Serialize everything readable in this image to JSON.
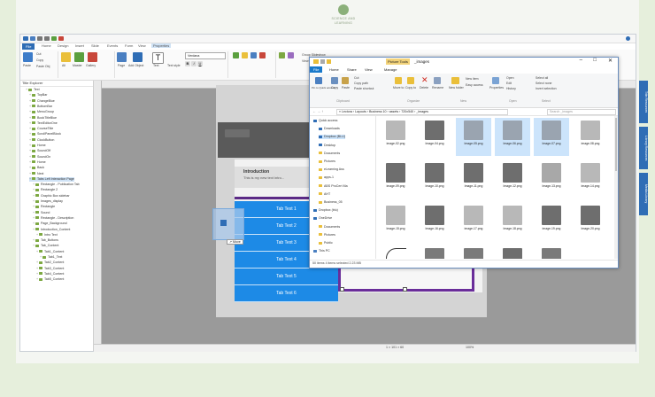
{
  "branding": {
    "line1": "SCIENCE AND",
    "line2": "LEARNING"
  },
  "app": {
    "ribbon_tabs": [
      "File",
      "Home",
      "Design",
      "Insert",
      "Slide",
      "Events",
      "Form",
      "View",
      "Properties"
    ],
    "ribbon": {
      "cut": "Cut",
      "copy": "Copy",
      "paste_obj": "Paste Obj",
      "paste": "Paste",
      "all": "All",
      "master": "Master",
      "gallery": "Gallery",
      "page": "Page",
      "add_object": "Add Object",
      "text": "Text",
      "text_style": "Text style",
      "font": "Verdana",
      "group_slideshow": "Group Slideshow",
      "view_style": "View Style"
    },
    "explorer": {
      "title": "Title Explorer",
      "items": [
        "Text",
        "TopBar",
        "ChangeBlue",
        "BottomBar",
        "MenuGroup",
        "BookTitleBlue",
        "TextEditorOne",
        "CourseTitle",
        "ScrollPanelBlock",
        "ClockButton",
        "Home",
        "SoundOff",
        "SoundOn",
        "Home",
        "Back",
        "Next",
        "Tabs Left Interaction Page",
        "Rectangle - Publication Tab",
        "Rectangle 2",
        "Graphic Box sidebar",
        "Images_display",
        "Rectangle",
        "Sound",
        "Rectangle - Description",
        "Page_Background",
        "Introduction_Content",
        "Intro Text",
        "Tab_Buttons",
        "Tab_Content",
        "Tab1_Content",
        "Tab1_Text",
        "Tab2_Content",
        "Tab3_Content",
        "Tab4_Content",
        "Tab5_Content"
      ]
    },
    "slide": {
      "intro_title": "Introduction",
      "intro_sub": "This is my new text intro...",
      "tabs": [
        "Tab Text 1",
        "Tab Text 2",
        "Tab Text 3",
        "Tab Text 4",
        "Tab Text 5",
        "Tab Text 6"
      ],
      "move_tip": "Move"
    },
    "status": {
      "zoom": "100%",
      "size": "1 × 101 × 60"
    },
    "right_tabs": [
      "Title Resources",
      "Library Resources",
      "Media Library"
    ]
  },
  "explorer_window": {
    "title": "_images",
    "picture_tools": "Picture Tools",
    "tabs": [
      "File",
      "Home",
      "Share",
      "View",
      "Manage"
    ],
    "ribbon": {
      "pin": "Pin to Quick access",
      "copy": "Copy",
      "paste": "Paste",
      "cut": "Cut",
      "copy_path": "Copy path",
      "paste_shortcut": "Paste shortcut",
      "move_to": "Move to",
      "copy_to": "Copy to",
      "delete": "Delete",
      "rename": "Rename",
      "new_folder": "New folder",
      "new_item": "New item",
      "easy_access": "Easy access",
      "properties": "Properties",
      "open": "Open",
      "edit": "Edit",
      "history": "History",
      "select_all": "Select all",
      "select_none": "Select none",
      "invert_selection": "Invert selection",
      "groups": [
        "Clipboard",
        "Organize",
        "New",
        "Open",
        "Select"
      ]
    },
    "address": "« Lectora › Layouts › Business 10 › assets › 720x540 › _images",
    "search_placeholder": "Search _images",
    "nav": [
      "Quick access",
      "Downloads",
      "Dropbox (BLU)",
      "Desktop",
      "Documents",
      "Pictures",
      "eLearning Ass",
      "apps-1",
      "ABS ProCert Ma",
      "AHT",
      "Business_05",
      "Dropbox (blu)",
      "OneDrive",
      "Documents",
      "Pictures",
      "Public",
      "This PC"
    ],
    "files": [
      "image-02.png",
      "Image-04.png",
      "Image-05.png",
      "Image-06.png",
      "Image-07.png",
      "image-08.png",
      "image-09.png",
      "Image-10.png",
      "Image-11.png",
      "Image-12.png",
      "Image-13.png",
      "image-14.png",
      "Image-15.png",
      "Image-16.png",
      "image-17.png",
      "Image-18.png",
      "image-19.png",
      "Image-20.png",
      "",
      "",
      "",
      "",
      ""
    ],
    "status": "50 items   4 items selected  2.23 MB"
  }
}
